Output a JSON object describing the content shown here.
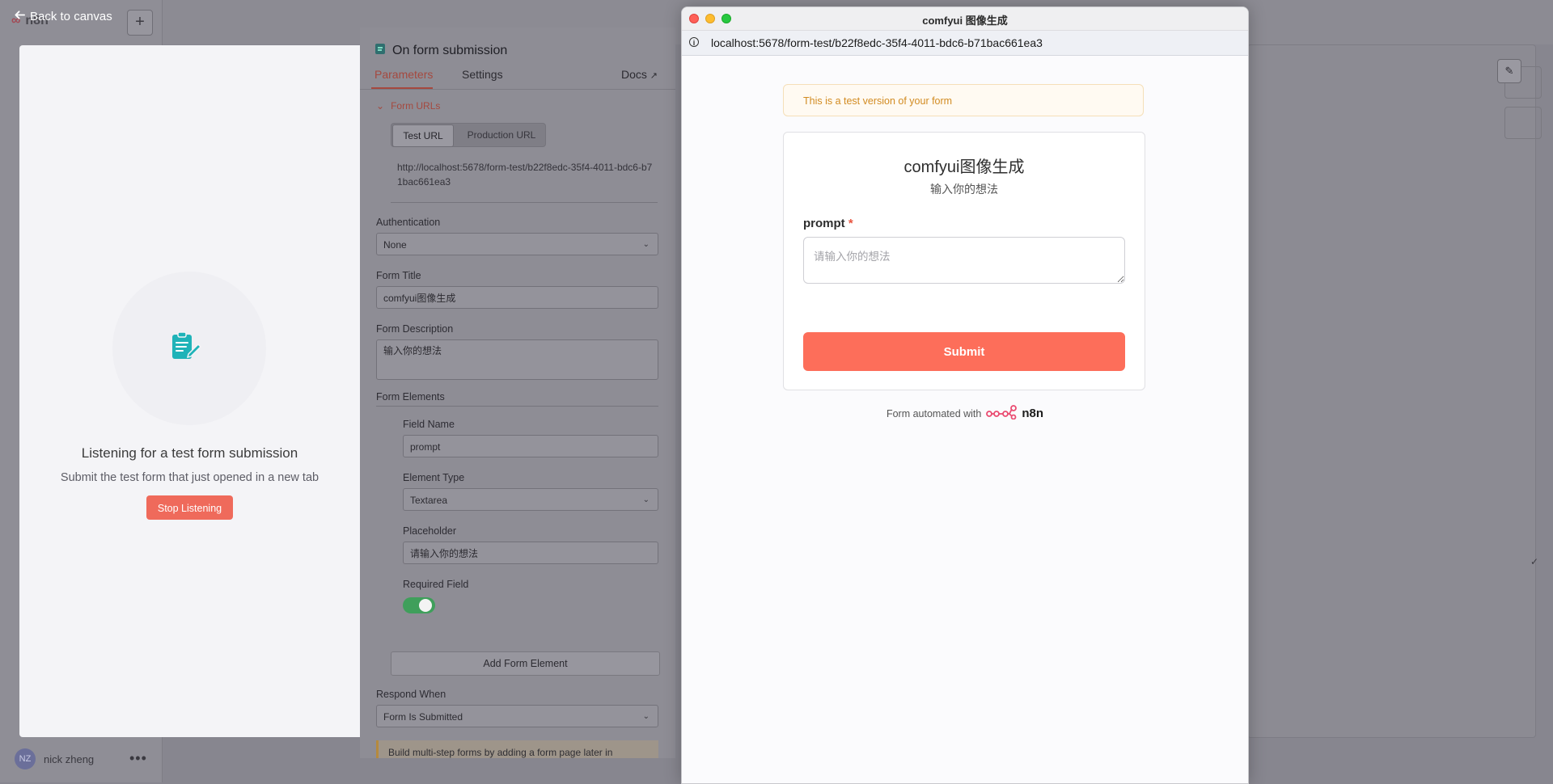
{
  "app": {
    "logo_text": "n8n",
    "back_label": "Back to canvas",
    "plus_label": "+",
    "user_initials": "NZ",
    "user_name": "nick zheng",
    "menu_dots": "•••"
  },
  "listening": {
    "title": "Listening for a test form submission",
    "subtitle": "Submit the test form that just opened in a new tab",
    "stop_label": "Stop Listening",
    "icon": "form-edit-icon",
    "accent": "#ef6a5b",
    "icon_color": "#1fb3b8"
  },
  "node": {
    "title": "On form submission",
    "tabs": {
      "parameters": "Parameters",
      "settings": "Settings",
      "docs": "Docs"
    },
    "form_urls_label": "Form URLs",
    "url_tabs": {
      "test": "Test URL",
      "production": "Production URL"
    },
    "test_url": "http://localhost:5678/form-test/b22f8edc-35f4-4011-bdc6-b71bac661ea3",
    "authentication_label": "Authentication",
    "authentication_value": "None",
    "form_title_label": "Form Title",
    "form_title_value": "comfyui图像生成",
    "form_description_label": "Form Description",
    "form_description_value": "输入你的想法",
    "form_elements_label": "Form Elements",
    "field_name_label": "Field Name",
    "field_name_value": "prompt",
    "element_type_label": "Element Type",
    "element_type_value": "Textarea",
    "placeholder_label": "Placeholder",
    "placeholder_value": "请输入你的想法",
    "required_label": "Required Field",
    "required_on": true,
    "add_element_label": "Add Form Element",
    "respond_when_label": "Respond When",
    "respond_when_value": "Form Is Submitted",
    "hint_text": "Build multi-step forms by adding a form page later in"
  },
  "popup": {
    "window_title": "comfyui 图像生成",
    "url": "localhost:5678/form-test/b22f8edc-35f4-4011-bdc6-b71bac661ea3",
    "test_banner": "This is a test version of your form",
    "form_title": "comfyui图像生成",
    "form_description": "输入你的想法",
    "prompt_label": "prompt",
    "required_mark": "*",
    "prompt_placeholder": "请输入你的想法",
    "submit_label": "Submit",
    "powered_text": "Form automated with",
    "powered_brand": "n8n",
    "submit_color": "#fd6e5a"
  }
}
